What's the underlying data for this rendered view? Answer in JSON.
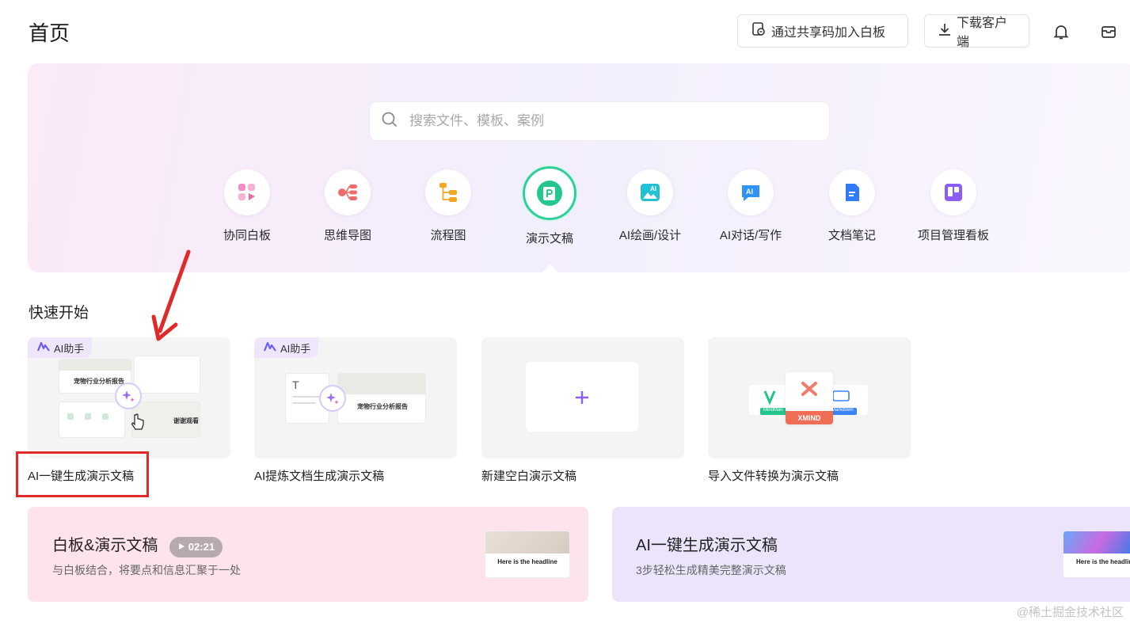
{
  "header": {
    "title": "首页",
    "join_button": "通过共享码加入白板",
    "download_button": "下载客户端"
  },
  "search": {
    "placeholder": "搜索文件、模板、案例"
  },
  "categories": [
    {
      "label": "协同白板",
      "icon": "whiteboard-icon"
    },
    {
      "label": "思维导图",
      "icon": "mindmap-icon"
    },
    {
      "label": "流程图",
      "icon": "flowchart-icon"
    },
    {
      "label": "演示文稿",
      "icon": "presentation-icon",
      "active": true
    },
    {
      "label": "AI绘画/设计",
      "icon": "ai-painting-icon"
    },
    {
      "label": "AI对话/写作",
      "icon": "ai-chat-icon"
    },
    {
      "label": "文档笔记",
      "icon": "document-icon"
    },
    {
      "label": "项目管理看板",
      "icon": "kanban-icon"
    }
  ],
  "quick_start": {
    "title": "快速开始",
    "badge": "AI助手",
    "cards": [
      {
        "label": "AI一键生成演示文稿",
        "thumb_title": "宠物行业分析报告",
        "thumb_text2": "谢谢观看"
      },
      {
        "label": "AI提炼文档生成演示文稿",
        "thumb_title": "宠物行业分析报告"
      },
      {
        "label": "新建空白演示文稿"
      },
      {
        "label": "导入文件转换为演示文稿",
        "thumb_formats": [
          "MindMan",
          "XMIND",
          "Markdown"
        ]
      }
    ]
  },
  "banners": [
    {
      "title": "白板&演示文稿",
      "duration": "02:21",
      "subtitle": "与白板结合，将要点和信息汇聚于一处",
      "thumb_headline": "Here is the headline"
    },
    {
      "title": "AI一键生成演示文稿",
      "subtitle": "3步轻松生成精美完整演示文稿",
      "thumb_headline": "Here is the headlin"
    }
  ],
  "watermark": "@稀土掘金技术社区",
  "colors": {
    "accent_green": "#2fcf9b",
    "highlight_red": "#e02a2a",
    "ai_purple": "#8b5cf6"
  }
}
